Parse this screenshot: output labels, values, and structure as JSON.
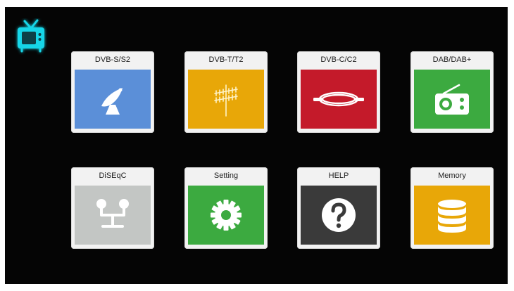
{
  "colors": {
    "background": "#050505",
    "tile_header": "#f2f2f2",
    "logo_glow": "#19d6e8"
  },
  "logo": {
    "icon": "tv-icon"
  },
  "menu": {
    "tiles": [
      {
        "label": "DVB-S/S2",
        "icon": "satellite-dish-icon",
        "color": "#5b8fd8"
      },
      {
        "label": "DVB-T/T2",
        "icon": "antenna-icon",
        "color": "#e8a708"
      },
      {
        "label": "DVB-C/C2",
        "icon": "cable-icon",
        "color": "#c41a2a"
      },
      {
        "label": "DAB/DAB+",
        "icon": "radio-icon",
        "color": "#3caa40"
      },
      {
        "label": "DiSEqC",
        "icon": "diseqc-switch-icon",
        "color": "#c3c6c4"
      },
      {
        "label": "Setting",
        "icon": "gear-icon",
        "color": "#3caa40"
      },
      {
        "label": "HELP",
        "icon": "question-icon",
        "color": "#3a3a3a"
      },
      {
        "label": "Memory",
        "icon": "database-icon",
        "color": "#e8a708"
      }
    ]
  }
}
